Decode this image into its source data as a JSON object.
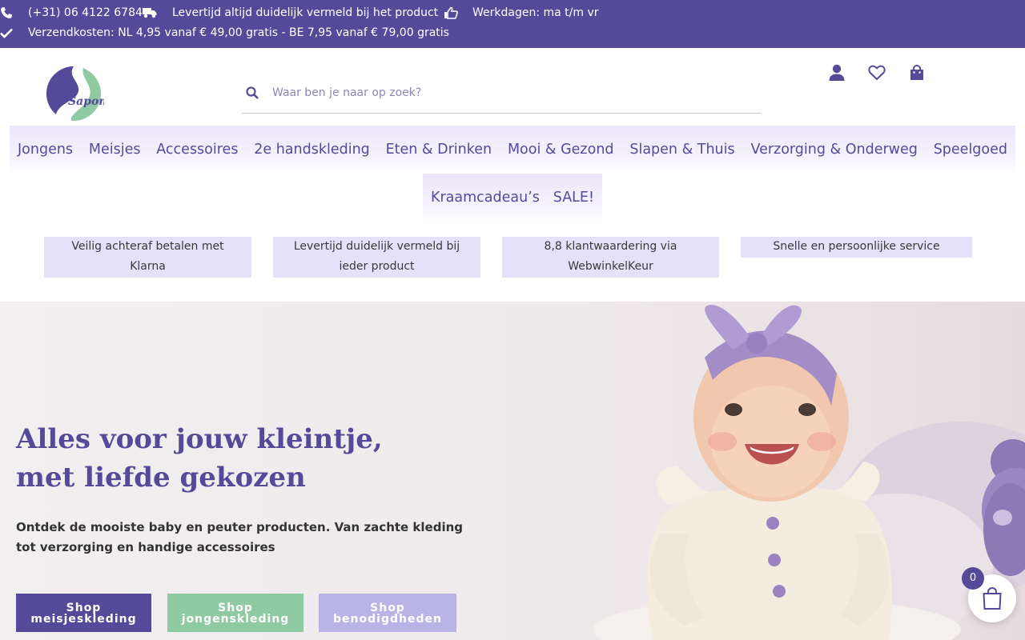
{
  "topbar": {
    "phone": "(+31) 06 4122 6784",
    "delivery": "Levertijd altijd duidelijk vermeld bij het product",
    "workdays": "Werkdagen: ma t/m vr",
    "shipping": "Verzendkosten: NL 4,95 vanaf € 49,00 gratis - BE 7,95 vanaf € 79,00 gratis",
    "icons": [
      "phone-icon",
      "truck-icon",
      "thumbs-up-icon",
      "check-icon"
    ]
  },
  "header": {
    "logo_text": "Saponi",
    "search_placeholder": "Waar ben je naar op zoek?",
    "icons": [
      "user-icon",
      "heart-icon",
      "shopping-bag-icon"
    ]
  },
  "nav": {
    "row1": [
      "Jongens",
      "Meisjes",
      "Accessoires",
      "2e handskleding",
      "Eten & Drinken",
      "Mooi & Gezond",
      "Slapen & Thuis",
      "Verzorging & Onderweg",
      "Speelgoed"
    ],
    "row2": [
      "Kraamcadeau’s",
      "SALE!"
    ]
  },
  "usps": [
    {
      "line1": "Veilig achteraf betalen met",
      "line2": "Klarna"
    },
    {
      "line1": "Levertijd duidelijk vermeld bij",
      "line2": "ieder product"
    },
    {
      "line1": "8,8 klantwaardering via",
      "line2": "WebwinkelKeur"
    },
    {
      "line1": "Snelle en persoonlijke service",
      "line2": ""
    }
  ],
  "hero": {
    "title_line1": "Alles voor jouw kleintje,",
    "title_line2": "met liefde gekozen",
    "subtitle": "Ontdek de mooiste baby en peuter producten. Van zachte kleding tot verzorging en handige accessoires",
    "buttons": [
      {
        "line1": "Shop",
        "line2": "meisjeskleding",
        "color": "#554a9a"
      },
      {
        "line1": "Shop",
        "line2": "jongenskleding",
        "color": "#8fcaa3"
      },
      {
        "line1": "Shop",
        "line2": "benodigdheden",
        "color": "#b9b3e6"
      }
    ]
  },
  "cart": {
    "count": "0"
  },
  "colors": {
    "brand": "#554a9a",
    "green": "#8fcaa3",
    "lilac": "#b9b3e6",
    "usp_bg": "#e4e1f8"
  }
}
